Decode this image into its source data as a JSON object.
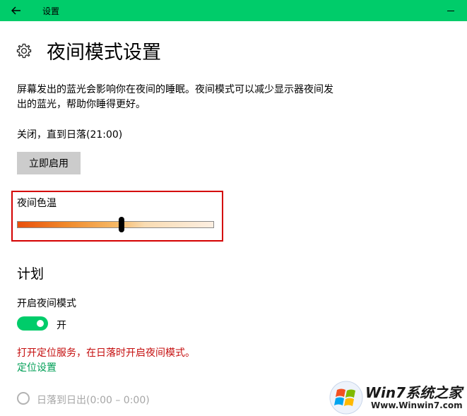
{
  "window": {
    "title": "设置"
  },
  "page": {
    "title": "夜间模式设置",
    "description": "屏幕发出的蓝光会影响你在夜间的睡眠。夜间模式可以减少显示器夜间发出的蓝光，帮助你睡得更好。",
    "status": "关闭，直到日落(21:00)",
    "enable_button": "立即启用"
  },
  "color_temperature": {
    "label": "夜间色温",
    "slider_value_fraction": 0.53
  },
  "schedule": {
    "heading": "计划",
    "toggle_label": "开启夜间模式",
    "toggle_state": "开",
    "location_warning": "打开定位服务，在日落时开启夜间模式。",
    "location_link": "定位设置",
    "sunset_option": "日落到日出(0:00 – 0:00)"
  },
  "watermark": {
    "brand": "Win7系统之家",
    "url": "Www.Winwin7.com"
  },
  "colors": {
    "accent": "#00cc6a",
    "warning": "#c50f0f",
    "highlight_border": "#d40000"
  }
}
